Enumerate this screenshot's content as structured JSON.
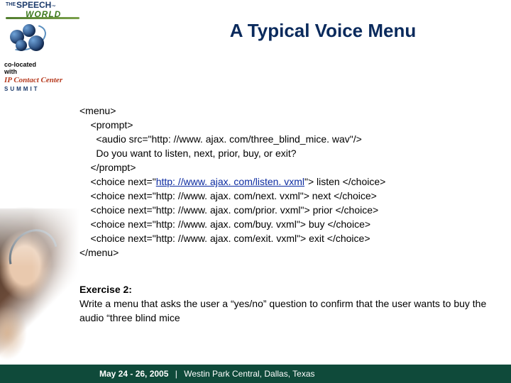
{
  "logo": {
    "the": "THE",
    "speech": "SPEECH",
    "tm": "™",
    "world": "WORLD"
  },
  "sidebar": {
    "colocated_l1": "co-located",
    "colocated_l2": "with",
    "ipcc_l1": "IP Contact Center",
    "ipcc_l2": "SUMMIT"
  },
  "title": "A Typical Voice Menu",
  "code": {
    "l1": "<menu>",
    "l2": "    <prompt>",
    "l3": "      <audio src=\"http: //www. ajax. com/three_blind_mice. wav\"/>",
    "l4": "      Do you want to listen, next, prior, buy, or exit?",
    "l5": "    </prompt>",
    "c1a": "    <choice next=\"",
    "c1link": "http: //www. ajax. com/listen. vxml",
    "c1b": "\"> listen </choice>",
    "c2": "    <choice next=\"http: //www. ajax. com/next. vxml\"> next </choice>",
    "c3": "    <choice next=\"http: //www. ajax. com/prior. vxml\"> prior </choice>",
    "c4": "    <choice next=\"http: //www. ajax. com/buy. vxml\"> buy </choice>",
    "c5": "    <choice next=\"http: //www. ajax. com/exit. vxml\"> exit </choice>",
    "l6": "</menu>"
  },
  "exercise": {
    "label": "Exercise 2:",
    "text": "Write a menu that asks the user a “yes/no” question to confirm that the user wants to buy the audio “three blind mice"
  },
  "footer": {
    "date": "May 24 - 26, 2005",
    "sep": "|",
    "location": "Westin Park Central, Dallas, Texas"
  }
}
